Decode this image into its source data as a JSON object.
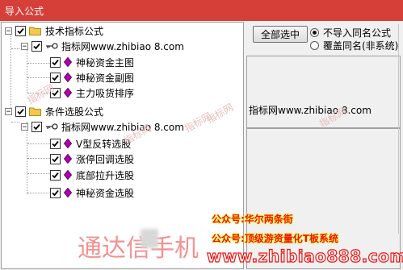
{
  "window": {
    "title": "导入公式"
  },
  "tree": {
    "groups": [
      {
        "label": "技术指标公式",
        "publisher": "指标网www.zhibiao  8.com",
        "items": [
          "神秘资金主图",
          "神秘资金副图",
          "主力吸货排序"
        ]
      },
      {
        "label": "条件选股公式",
        "publisher": "指标网www.zhibiao  8.com",
        "items": [
          "V型反转选股",
          "涨停回调选股",
          "底部拉升选股",
          "神秘资金选股"
        ]
      }
    ]
  },
  "right": {
    "select_all_label": "全部选中",
    "radio_skip_label": "不导入同名公式",
    "radio_overwrite_label": "覆盖同名(非系统)",
    "info_text": "指标网www.zhibiao  8.com"
  },
  "watermarks": {
    "diagonal": "指标网",
    "ad_line1": "公众号:华尔两条街",
    "ad_line2": "公众号:顶级游资量化T板系统",
    "ad_line3": "www.zhibiao888.com",
    "big_text": "通达信手机"
  },
  "colors": {
    "title_bar": "#d63f38",
    "gem": "#b000b0",
    "folder": "#f2c94c"
  }
}
